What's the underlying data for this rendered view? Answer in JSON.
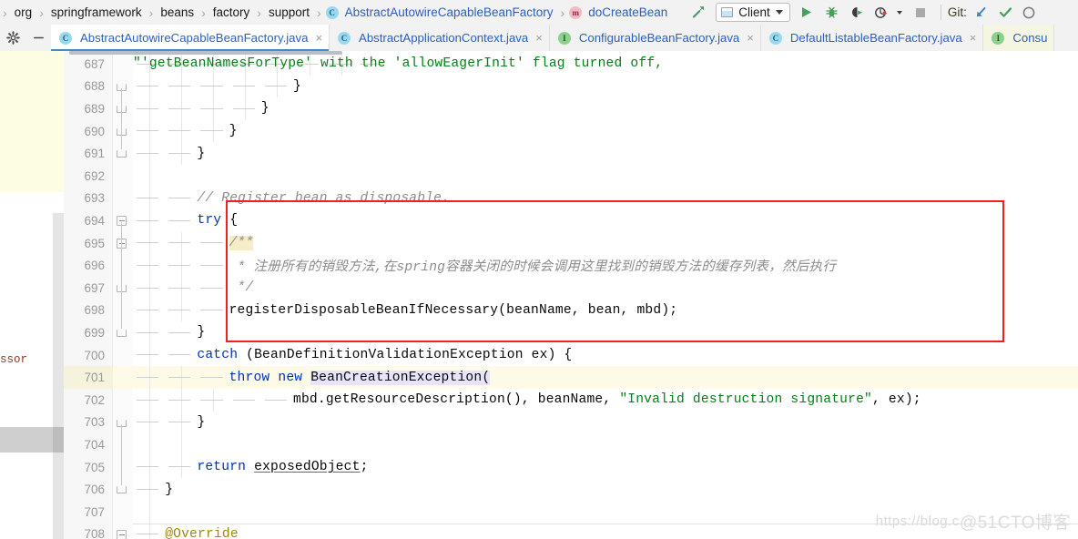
{
  "navbar": {
    "breadcrumbs": [
      {
        "label": "org",
        "icon": null,
        "kind": "plain"
      },
      {
        "label": "springframework",
        "icon": null,
        "kind": "plain"
      },
      {
        "label": "beans",
        "icon": null,
        "kind": "plain"
      },
      {
        "label": "factory",
        "icon": null,
        "kind": "plain"
      },
      {
        "label": "support",
        "icon": null,
        "kind": "plain"
      },
      {
        "label": "AbstractAutowireCapableBeanFactory",
        "icon": "class-icon",
        "kind": "class"
      },
      {
        "label": "doCreateBean",
        "icon": "method-icon",
        "kind": "method"
      }
    ],
    "separator": "›",
    "class_badge": "C",
    "method_badge": "m",
    "interface_badge": "I",
    "run_config": {
      "label": "Client",
      "icon": "run-configuration-icon"
    },
    "actions": [
      {
        "name": "build-hammer-icon",
        "title": "Build"
      },
      {
        "name": "run-icon",
        "title": "Run"
      },
      {
        "name": "debug-icon",
        "title": "Debug"
      },
      {
        "name": "run-with-coverage-icon",
        "title": "Run with Coverage"
      },
      {
        "name": "profiler-icon",
        "title": "Profiler"
      },
      {
        "name": "stop-icon",
        "title": "Stop"
      }
    ],
    "git": {
      "label": "Git:",
      "update_icon": "git-update-project-icon",
      "commit_icon": "git-commit-checkmark-icon",
      "history_icon": "git-history-icon"
    }
  },
  "tabbar": {
    "settings_icon": "gear-icon",
    "minimize_icon": "minimize-icon",
    "close_glyph": "×",
    "tabs": [
      {
        "label": "AbstractAutowireCapableBeanFactory.java",
        "badge": "C",
        "kind": "class",
        "active": true,
        "closable": true
      },
      {
        "label": "AbstractApplicationContext.java",
        "badge": "C",
        "kind": "class",
        "active": false,
        "closable": true
      },
      {
        "label": "ConfigurableBeanFactory.java",
        "badge": "I",
        "kind": "interface",
        "active": false,
        "closable": true
      },
      {
        "label": "DefaultListableBeanFactory.java",
        "badge": "C",
        "kind": "class",
        "active": false,
        "closable": true
      },
      {
        "label": "Consu",
        "badge": "I",
        "kind": "interface",
        "active": false,
        "closable": false
      }
    ]
  },
  "background_panel": {
    "fragment_text": "ssor"
  },
  "editor": {
    "first_line": 687,
    "current_line": 701,
    "lines": [
      {
        "n": 687,
        "indent": 0,
        "tokens": [
          {
            "t": "\"'getBeanNamesForType' with the 'allowEagerInit' flag turned off,",
            "c": "str"
          }
        ],
        "clipped_top": true,
        "dashes": 8,
        "guides": [
          1,
          2,
          3,
          4,
          5,
          6,
          7
        ]
      },
      {
        "n": 688,
        "indent": 5,
        "tokens": [
          {
            "t": "}",
            "c": ""
          }
        ],
        "fold": "end",
        "dashes": 5,
        "guides": [
          1,
          2,
          3,
          4,
          5
        ]
      },
      {
        "n": 689,
        "indent": 4,
        "tokens": [
          {
            "t": "}",
            "c": ""
          }
        ],
        "fold": "end",
        "dashes": 4,
        "guides": [
          1,
          2,
          3,
          4
        ]
      },
      {
        "n": 690,
        "indent": 3,
        "tokens": [
          {
            "t": "}",
            "c": ""
          }
        ],
        "fold": "end",
        "dashes": 3,
        "guides": [
          1,
          2,
          3
        ]
      },
      {
        "n": 691,
        "indent": 2,
        "tokens": [
          {
            "t": "}",
            "c": ""
          }
        ],
        "fold": "end",
        "dashes": 2,
        "guides": [
          1,
          2
        ]
      },
      {
        "n": 692,
        "indent": 0,
        "tokens": [],
        "dashes": 0,
        "guides": [
          1
        ]
      },
      {
        "n": 693,
        "indent": 2,
        "tokens": [
          {
            "t": "// Register bean as disposable.",
            "c": "cmt"
          }
        ],
        "dashes": 2,
        "guides": [
          1
        ]
      },
      {
        "n": 694,
        "indent": 2,
        "tokens": [
          {
            "t": "try",
            "c": "kw"
          },
          {
            "t": " {",
            "c": ""
          }
        ],
        "fold": "start",
        "dashes": 2,
        "guides": [
          1
        ]
      },
      {
        "n": 695,
        "indent": 3,
        "tokens": [
          {
            "t": "/**",
            "c": "cmt hl-doc"
          }
        ],
        "fold": "start",
        "dashes": 3,
        "guides": [
          1,
          2
        ]
      },
      {
        "n": 696,
        "indent": 3,
        "tokens": [
          {
            "t": " * 注册所有的销毁方法,在spring容器关闭的时候会调用这里找到的销毁方法的缓存列表，然后执行",
            "c": "cmt"
          }
        ],
        "dashes": 3,
        "guides": [
          1,
          2
        ]
      },
      {
        "n": 697,
        "indent": 3,
        "tokens": [
          {
            "t": " */",
            "c": "cmt"
          }
        ],
        "fold": "end",
        "dashes": 3,
        "guides": [
          1,
          2
        ]
      },
      {
        "n": 698,
        "indent": 3,
        "tokens": [
          {
            "t": "registerDisposableBeanIfNecessary(beanName, bean, mbd);",
            "c": ""
          }
        ],
        "dashes": 3,
        "guides": [
          1,
          2
        ]
      },
      {
        "n": 699,
        "indent": 2,
        "tokens": [
          {
            "t": "}",
            "c": ""
          }
        ],
        "fold": "end",
        "dashes": 2,
        "guides": [
          1
        ]
      },
      {
        "n": 700,
        "indent": 2,
        "tokens": [
          {
            "t": "catch",
            "c": "kw"
          },
          {
            "t": " (BeanDefinitionValidationException ex) {",
            "c": ""
          }
        ],
        "dashes": 2,
        "guides": [
          1
        ]
      },
      {
        "n": 701,
        "indent": 3,
        "tokens": [
          {
            "t": "throw",
            "c": "kw"
          },
          {
            "t": " ",
            "c": ""
          },
          {
            "t": "new",
            "c": "kw"
          },
          {
            "t": " ",
            "c": ""
          },
          {
            "t": "BeanCreationException(",
            "c": "hl-sel"
          }
        ],
        "current": true,
        "dashes": 3,
        "guides": [
          1,
          2
        ]
      },
      {
        "n": 702,
        "indent": 5,
        "tokens": [
          {
            "t": "mbd.getResourceDescription(), beanName, ",
            "c": ""
          },
          {
            "t": "\"Invalid destruction signature\"",
            "c": "str"
          },
          {
            "t": ", ex);",
            "c": ""
          }
        ],
        "dashes": 5,
        "guides": [
          1,
          2,
          3
        ]
      },
      {
        "n": 703,
        "indent": 2,
        "tokens": [
          {
            "t": "}",
            "c": ""
          }
        ],
        "fold": "end",
        "dashes": 2,
        "guides": [
          1,
          2
        ]
      },
      {
        "n": 704,
        "indent": 0,
        "tokens": [],
        "dashes": 0,
        "guides": [
          1,
          2
        ]
      },
      {
        "n": 705,
        "indent": 2,
        "tokens": [
          {
            "t": "return",
            "c": "kw"
          },
          {
            "t": " ",
            "c": ""
          },
          {
            "t": "exposedObject",
            "c": "ul"
          },
          {
            "t": ";",
            "c": ""
          }
        ],
        "dashes": 2,
        "guides": [
          1,
          2
        ]
      },
      {
        "n": 706,
        "indent": 1,
        "tokens": [
          {
            "t": "}",
            "c": ""
          }
        ],
        "fold": "end",
        "dashes": 1,
        "guides": [
          1
        ]
      },
      {
        "n": 707,
        "indent": 0,
        "tokens": [],
        "dashes": 0,
        "guides": [
          1
        ]
      },
      {
        "n": 708,
        "indent": 1,
        "tokens": [
          {
            "t": "@Override",
            "c": "anno"
          }
        ],
        "fold": "start",
        "dashes": 1,
        "guides": [
          1
        ],
        "method_separator": true
      }
    ]
  },
  "annotation": {
    "type": "red-rectangle",
    "covers_lines": [
      694,
      699
    ],
    "color": "#f21f1f"
  },
  "watermark": {
    "url_text": "https://blog.c",
    "brand_text": "@51CTO博客"
  }
}
